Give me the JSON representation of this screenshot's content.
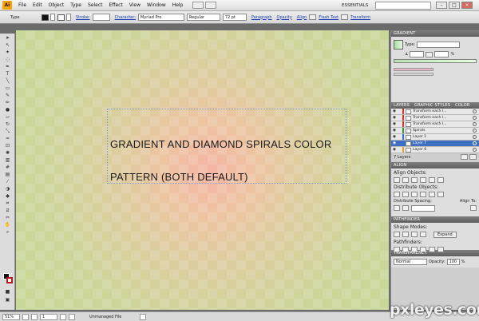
{
  "menubar": {
    "logo": "Ai",
    "items": [
      "File",
      "Edit",
      "Object",
      "Type",
      "Select",
      "Effect",
      "View",
      "Window",
      "Help"
    ],
    "workspace": "ESSENTIALS"
  },
  "controlbar": {
    "tool_label": "Type",
    "stroke_label": "Stroke:",
    "character_label": "Character:",
    "font_family": "Myriad Pro",
    "font_style": "Regular",
    "font_size": "72 pt",
    "paragraph_label": "Paragraph",
    "opacity_label": "Opacity",
    "align_label": "Align",
    "flash_text_label": "Flash Text",
    "transform_label": "Transform"
  },
  "canvas": {
    "caption_line1": "GRADIENT AND DIAMOND SPIRALS COLOR",
    "caption_line2": "PATTERN (BOTH DEFAULT)"
  },
  "panels": {
    "gradient": {
      "title": "GRADIENT",
      "type_label": "Type:",
      "percent": "%"
    },
    "layers": {
      "tab_layers": "LAYERS",
      "tab_styles": "GRAPHIC STYLES",
      "tab_color": "COLOR",
      "rows": [
        {
          "name": "Transform each l...",
          "color": "#d0332f",
          "selected": false
        },
        {
          "name": "Transform each l...",
          "color": "#d0332f",
          "selected": false
        },
        {
          "name": "Transform each l...",
          "color": "#d0332f",
          "selected": false
        },
        {
          "name": "Spirals",
          "color": "#3f8f3f",
          "selected": false
        },
        {
          "name": "Layer 1",
          "color": "#3a6cd0",
          "selected": false
        },
        {
          "name": "Layer 7",
          "color": "#3a6cd0",
          "selected": true
        },
        {
          "name": "Layer 6",
          "color": "#e0a030",
          "selected": false
        }
      ],
      "count": "7 Layers"
    },
    "align": {
      "title": "ALIGN",
      "align_objects": "Align Objects:",
      "distribute_objects": "Distribute Objects:",
      "distribute_spacing": "Distribute Spacing:",
      "align_to": "Align To:"
    },
    "pathfinder": {
      "title": "PATHFINDER",
      "shape_modes": "Shape Modes:",
      "expand": "Expand",
      "pathfinders": "Pathfinders:"
    },
    "transparency": {
      "title": "TRANSPARENCY",
      "blend_mode": "Normal",
      "opacity_label": "Opacity:",
      "opacity_value": "100",
      "percent": "%"
    }
  },
  "statusbar": {
    "zoom": "51%",
    "page": "1",
    "status": "Unmanaged File"
  },
  "watermark": "pxleyes.com"
}
